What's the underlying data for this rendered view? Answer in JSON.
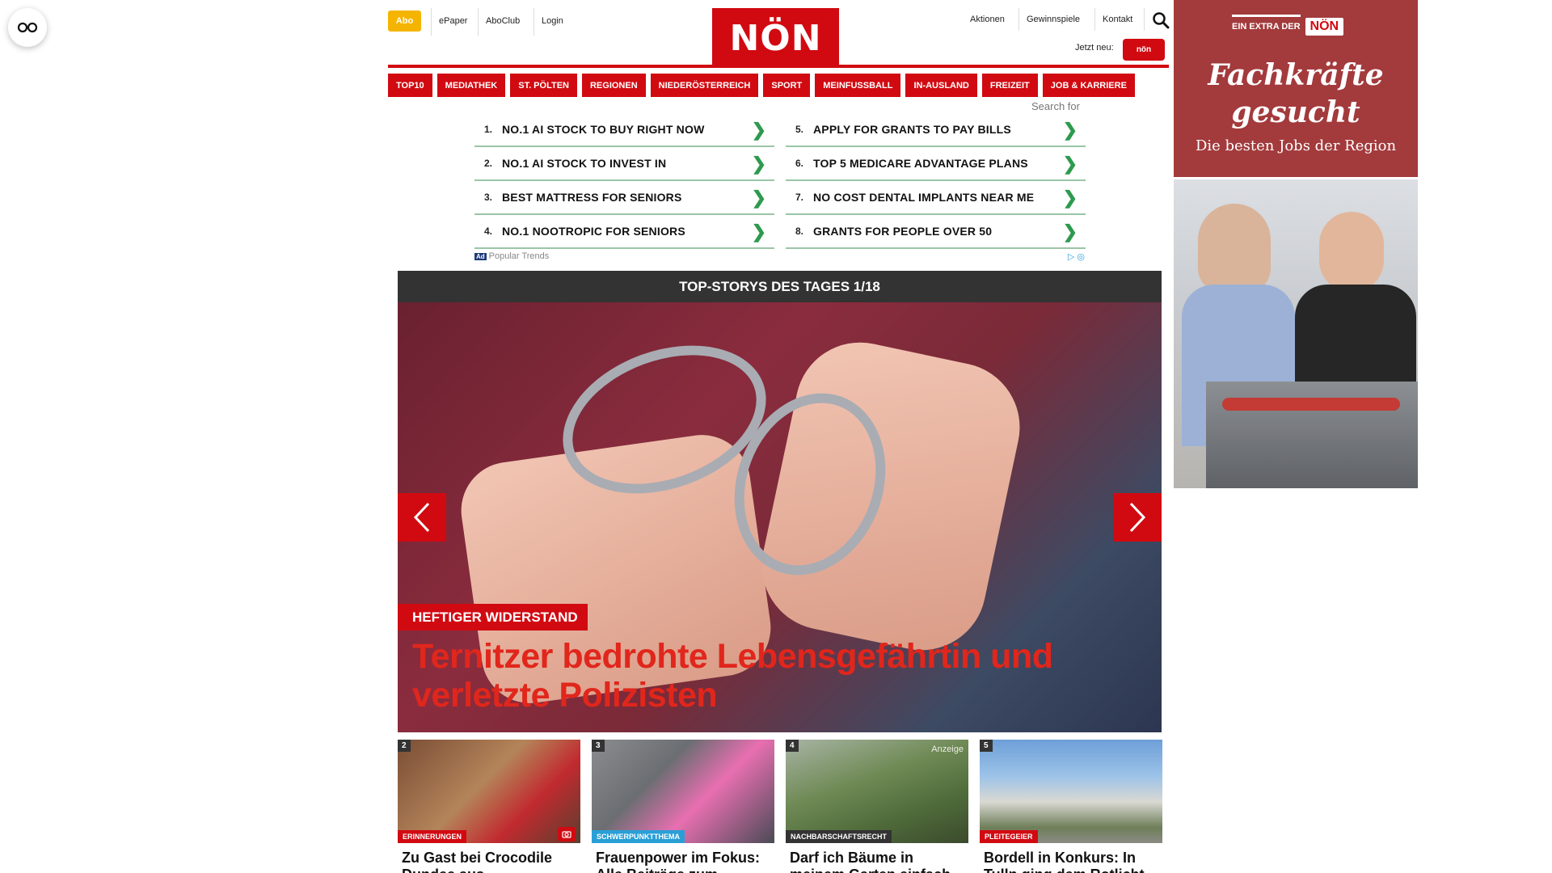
{
  "header": {
    "abo": "Abo",
    "epaper": "ePaper",
    "aboclub": "AboClub",
    "login": "Login",
    "logo": "NÖN",
    "aktionen": "Aktionen",
    "gewinnspiele": "Gewinnspiele",
    "kontakt": "Kontakt",
    "jetzt_neu": "Jetzt neu:",
    "jetzt_badge": "nön"
  },
  "nav": [
    "TOP10",
    "MEDIATHEK",
    "ST. PÖLTEN",
    "REGIONEN",
    "NIEDERÖSTERREICH",
    "SPORT",
    "MEINFUSSBALL",
    "IN-AUSLAND",
    "FREIZEIT",
    "JOB & KARRIERE"
  ],
  "ad_search": {
    "label": "Search for",
    "items": [
      {
        "num": "1.",
        "text": "NO.1 AI STOCK TO BUY RIGHT NOW"
      },
      {
        "num": "5.",
        "text": "APPLY FOR GRANTS TO PAY BILLS"
      },
      {
        "num": "2.",
        "text": "NO.1 AI STOCK TO INVEST IN"
      },
      {
        "num": "6.",
        "text": "TOP 5 MEDICARE ADVANTAGE PLANS"
      },
      {
        "num": "3.",
        "text": "BEST MATTRESS FOR SENIORS"
      },
      {
        "num": "7.",
        "text": "NO COST DENTAL IMPLANTS NEAR ME"
      },
      {
        "num": "4.",
        "text": "NO.1 NOOTROPIC FOR SENIORS"
      },
      {
        "num": "8.",
        "text": "GRANTS FOR PEOPLE OVER 50"
      }
    ],
    "ad_badge": "Ad",
    "provider": "Popular Trends"
  },
  "stories": {
    "heading": "TOP-STORYS DES TAGES 1/18",
    "hero_kicker": "HEFTIGER WIDERSTAND",
    "hero_title": "Ternitzer bedrohte Lebensgefährtin und verletzte Polizisten",
    "thumbs": [
      {
        "num": "2",
        "tag": "ERINNERUNGEN",
        "tag_color": "#d10a11",
        "title": "Zu Gast bei Crocodile Dundee aus"
      },
      {
        "num": "3",
        "tag": "SCHWERPUNKTTHEMA",
        "tag_color": "#2a9fd6",
        "title": "Frauenpower im Fokus: Alle Beiträge zum"
      },
      {
        "num": "4",
        "tag": "NACHBARSCHAFTSRECHT",
        "tag_color": "#333333",
        "anzeige": "Anzeige",
        "title": "Darf ich Bäume in meinem Garten einfach"
      },
      {
        "num": "5",
        "tag": "PLEITEGEIER",
        "tag_color": "#d10a11",
        "title": "Bordell in Konkurs: In Tulln ging dem Rotlicht"
      }
    ]
  },
  "right_ad": {
    "extra": "EIN EXTRA DER",
    "logo": "NÖN",
    "headline_line1": "Fachkräfte",
    "headline_line2": "gesucht",
    "sub": "Die besten Jobs der Region"
  },
  "colors": {
    "brand_red": "#d10a11",
    "abo_yellow": "#f5b400",
    "ad_green": "#2e9a4e"
  }
}
